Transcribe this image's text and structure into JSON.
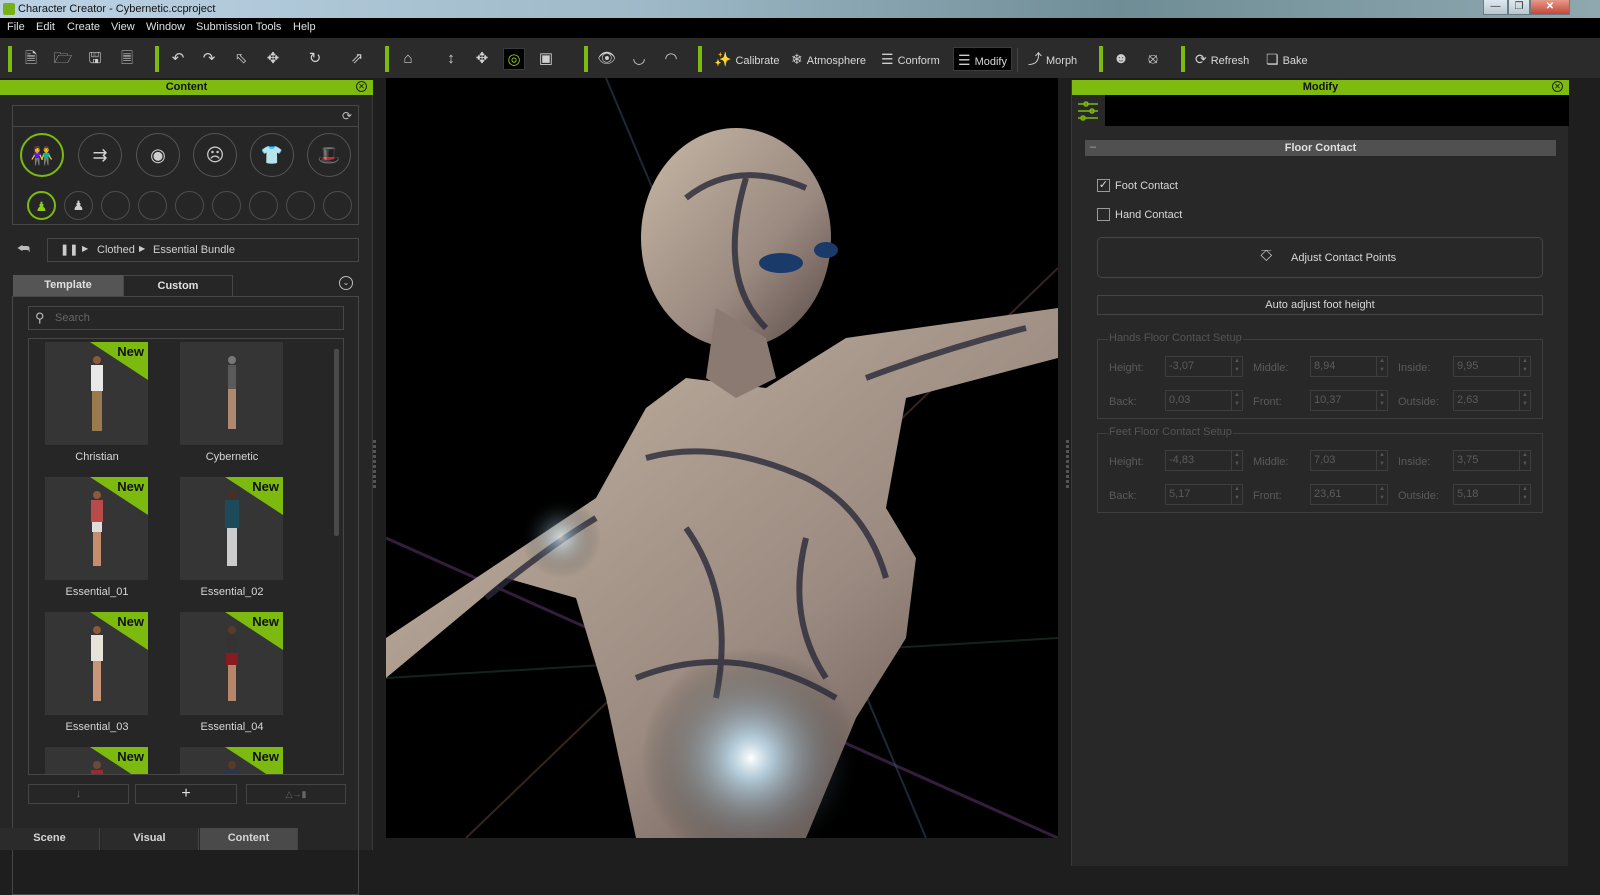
{
  "window": {
    "title": "Character Creator - Cybernetic.ccproject",
    "controls": [
      "minimize",
      "restore",
      "close"
    ]
  },
  "menu": [
    "File",
    "Edit",
    "Create",
    "View",
    "Window",
    "Submission Tools",
    "Help"
  ],
  "toolbar": {
    "file_icons": [
      "new-file-icon",
      "open-folder-icon",
      "save-icon",
      "export-icon"
    ],
    "edit_icons": [
      "undo-icon",
      "redo-icon",
      "select-arrow-icon",
      "move-icon",
      "rotate-icon",
      "scale-icon"
    ],
    "view_icons": [
      "home-icon",
      "fit-vertical-icon",
      "fit-all-icon",
      "focus-icon",
      "frame-icon"
    ],
    "eye_icons": [
      "eye-icon",
      "lips-icon",
      "teeth-icon"
    ],
    "buttons": {
      "calibrate": "Calibrate",
      "atmosphere": "Atmosphere",
      "conform": "Conform",
      "modify": "Modify",
      "morph": "Morph",
      "refresh": "Refresh",
      "bake": "Bake"
    },
    "active": "Modify"
  },
  "content_panel": {
    "title": "Content",
    "categories": [
      "character",
      "morph",
      "skin",
      "head",
      "clothing",
      "accessory"
    ],
    "active_category": "character",
    "subcategories_count": 9,
    "breadcrumb": [
      "Clothed",
      "Essential Bundle"
    ],
    "tabs": [
      "Template",
      "Custom"
    ],
    "active_tab": "Template",
    "search_placeholder": "Search",
    "items": [
      {
        "label": "Christian",
        "new": true
      },
      {
        "label": "Cybernetic",
        "new": false
      },
      {
        "label": "Essential_01",
        "new": true
      },
      {
        "label": "Essential_02",
        "new": true
      },
      {
        "label": "Essential_03",
        "new": true
      },
      {
        "label": "Essential_04",
        "new": true
      },
      {
        "label": "",
        "new": true
      },
      {
        "label": "",
        "new": true
      }
    ],
    "new_badge": "New",
    "bottom_buttons": [
      "download",
      "add",
      "replace"
    ],
    "add_symbol": "+"
  },
  "bottom_tabs": [
    "Scene",
    "Visual",
    "Content"
  ],
  "active_bottom_tab": "Content",
  "modify_panel": {
    "title": "Modify",
    "section_title": "Floor Contact",
    "foot_contact": {
      "label": "Foot Contact",
      "checked": true
    },
    "hand_contact": {
      "label": "Hand Contact",
      "checked": false
    },
    "adjust_contact_points": "Adjust Contact Points",
    "auto_adjust": "Auto adjust foot height",
    "hands_group": {
      "title": "Hands Floor Contact Setup",
      "fields": [
        {
          "label": "Height:",
          "value": "-3,07"
        },
        {
          "label": "Middle:",
          "value": "8,94"
        },
        {
          "label": "Inside:",
          "value": "9,95"
        },
        {
          "label": "Back:",
          "value": "0,03"
        },
        {
          "label": "Front:",
          "value": "10,37"
        },
        {
          "label": "Outside:",
          "value": "2,63"
        }
      ]
    },
    "feet_group": {
      "title": "Feet Floor Contact Setup",
      "fields": [
        {
          "label": "Height:",
          "value": "-4,83"
        },
        {
          "label": "Middle:",
          "value": "7,03"
        },
        {
          "label": "Inside:",
          "value": "3,75"
        },
        {
          "label": "Back:",
          "value": "5,17"
        },
        {
          "label": "Front:",
          "value": "23,61"
        },
        {
          "label": "Outside:",
          "value": "5,18"
        }
      ]
    }
  },
  "colors": {
    "accent": "#7cba10",
    "panel_bg": "#262626",
    "toolbar_bg": "#2b2b2b"
  }
}
